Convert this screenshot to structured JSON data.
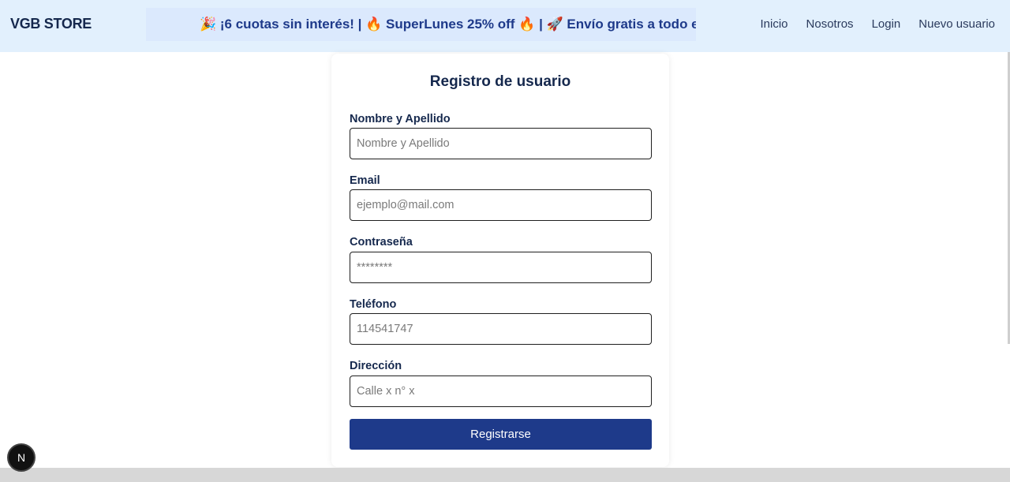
{
  "navbar": {
    "brand": "VGB STORE",
    "announcement": "🎉 ¡6 cuotas sin interés! | 🔥 SuperLunes 25% off 🔥 | 🚀 Envío gratis a todo el",
    "links": [
      "Inicio",
      "Nosotros",
      "Login",
      "Nuevo usuario"
    ]
  },
  "form": {
    "title": "Registro de usuario",
    "fields": [
      {
        "label": "Nombre y Apellido",
        "placeholder": "Nombre y Apellido"
      },
      {
        "label": "Email",
        "placeholder": "ejemplo@mail.com"
      },
      {
        "label": "Contraseña",
        "placeholder": "********"
      },
      {
        "label": "Teléfono",
        "placeholder": "114541747"
      },
      {
        "label": "Dirección",
        "placeholder": "Calle x n° x"
      }
    ],
    "submit_label": "Registrarse"
  },
  "dev_badge": {
    "letter": "N"
  },
  "colors": {
    "navbar_bg": "#e2f0fd",
    "primary": "#1e3a8a",
    "text_dark": "#15284d"
  }
}
